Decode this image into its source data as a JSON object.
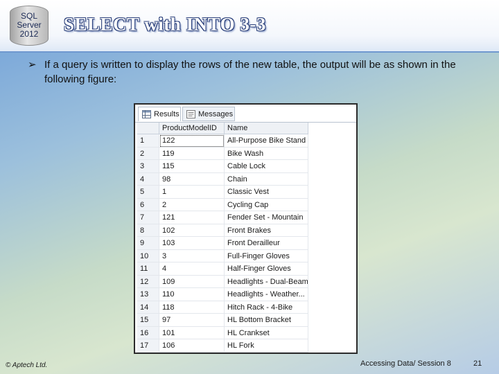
{
  "logo": {
    "line1": "SQL",
    "line2": "Server",
    "line3": "2012"
  },
  "slide": {
    "title": "SELECT with INTO 3-3",
    "bullet": "If a query is written to display the rows of the new table, the output will be as shown in the following figure:"
  },
  "results": {
    "tabs": [
      {
        "label": "Results"
      },
      {
        "label": "Messages"
      }
    ],
    "columns": [
      "ProductModelID",
      "Name"
    ],
    "rows": [
      {
        "n": "1",
        "id": "122",
        "name": "All-Purpose Bike Stand"
      },
      {
        "n": "2",
        "id": "119",
        "name": "Bike Wash"
      },
      {
        "n": "3",
        "id": "115",
        "name": "Cable Lock"
      },
      {
        "n": "4",
        "id": "98",
        "name": "Chain"
      },
      {
        "n": "5",
        "id": "1",
        "name": "Classic Vest"
      },
      {
        "n": "6",
        "id": "2",
        "name": "Cycling Cap"
      },
      {
        "n": "7",
        "id": "121",
        "name": "Fender Set - Mountain"
      },
      {
        "n": "8",
        "id": "102",
        "name": "Front Brakes"
      },
      {
        "n": "9",
        "id": "103",
        "name": "Front Derailleur"
      },
      {
        "n": "10",
        "id": "3",
        "name": "Full-Finger Gloves"
      },
      {
        "n": "11",
        "id": "4",
        "name": "Half-Finger Gloves"
      },
      {
        "n": "12",
        "id": "109",
        "name": "Headlights - Dual-Beam"
      },
      {
        "n": "13",
        "id": "110",
        "name": "Headlights - Weather..."
      },
      {
        "n": "14",
        "id": "118",
        "name": "Hitch Rack - 4-Bike"
      },
      {
        "n": "15",
        "id": "97",
        "name": "HL Bottom Bracket"
      },
      {
        "n": "16",
        "id": "101",
        "name": "HL Crankset"
      },
      {
        "n": "17",
        "id": "106",
        "name": "HL Fork"
      }
    ]
  },
  "footer": {
    "left": "© Aptech Ltd.",
    "middle": "Accessing Data/ Session 8",
    "page": "21"
  }
}
